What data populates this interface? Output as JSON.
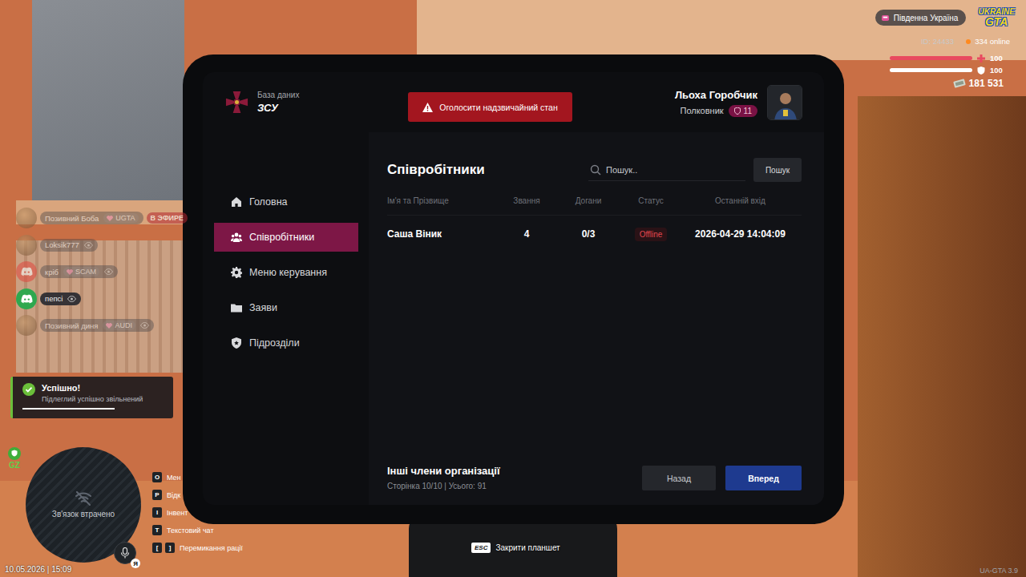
{
  "hud": {
    "region": "Південна Україна",
    "logo": {
      "top": "UKRAINE",
      "bottom": "GTA"
    },
    "player_id": "ID: 24433",
    "online": "334 online",
    "health": {
      "value": "100",
      "level": 1
    },
    "armor": {
      "value": "100",
      "level": 1
    },
    "money": "181 531",
    "zone": "GZ",
    "minimap_status": "Зв'язок втрачено",
    "mic_badge": "Я",
    "datetime": "10.05.2026 | 15:09",
    "close_hint": {
      "key": "ESC",
      "label": "Закрити планшет"
    },
    "version": "UA-GTA 3.9"
  },
  "voice_list": [
    {
      "name": "Позивний Боба",
      "tag": "UGTA",
      "live": "В ЭФИРЕ",
      "kind": "photo",
      "spectating": false,
      "speaking": false
    },
    {
      "name": "Loksik777",
      "kind": "photo",
      "spectating": true,
      "speaking": false
    },
    {
      "name": "кріб",
      "tag": "SCAM",
      "kind": "discord",
      "color": "#e0473e",
      "spectating": true,
      "speaking": false
    },
    {
      "name": "пепсі",
      "kind": "discord",
      "color": "#2fa84f",
      "spectating": true,
      "speaking": true
    },
    {
      "name": "Позивний диня",
      "tag": "AUDI",
      "kind": "photo",
      "spectating": true,
      "speaking": false
    }
  ],
  "notification": {
    "title": "Успішно!",
    "message": "Підлеглий успішно звільнений",
    "level": 0.64
  },
  "key_hints": [
    {
      "keys": [
        "O"
      ],
      "label": "Мен"
    },
    {
      "keys": [
        "P"
      ],
      "label": "Відк"
    },
    {
      "keys": [
        "I"
      ],
      "label": "Інвент"
    },
    {
      "keys": [
        "T"
      ],
      "label": "Текстовий чат"
    },
    {
      "keys": [
        "[",
        "]"
      ],
      "label": "Перемикання рації"
    }
  ],
  "tablet": {
    "brand": {
      "subtitle": "База даних",
      "title": "ЗСУ"
    },
    "emergency_button": "Оголосити надзвичайний стан",
    "user": {
      "name": "Льоха Горобчик",
      "rank": "Полковник",
      "level": "11"
    },
    "nav": [
      {
        "label": "Головна",
        "selected": false
      },
      {
        "label": "Співробітники",
        "selected": true
      },
      {
        "label": "Меню керування",
        "selected": false
      },
      {
        "label": "Заяви",
        "selected": false
      },
      {
        "label": "Підрозділи",
        "selected": false
      }
    ],
    "page": {
      "title": "Співробітники",
      "search": {
        "placeholder": "Пошук..",
        "button": "Пошук"
      },
      "table": {
        "columns": [
          "Ім'я та Прізвище",
          "Звання",
          "Догани",
          "Статус",
          "Останній вхід"
        ],
        "rows": [
          {
            "name": "Саша Віник",
            "rank": "4",
            "reprimands": "0/3",
            "status": "Offline",
            "last_login": "2026-04-29 14:04:09"
          }
        ]
      },
      "footer": {
        "title": "Інші члени організації",
        "pagination": "Сторінка 10/10 | Усього: 91",
        "buttons": [
          {
            "label": "Назад",
            "primary": false
          },
          {
            "label": "Вперед",
            "primary": true
          }
        ]
      }
    }
  }
}
